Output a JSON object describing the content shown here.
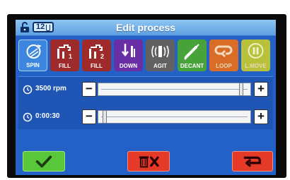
{
  "header": {
    "title": "Edit process",
    "lock_icon": "unlock-icon",
    "tube_count": "12"
  },
  "steps": [
    {
      "label": "SPIN",
      "icon": "spin-icon",
      "color": "#3d86e0",
      "selected": true
    },
    {
      "label": "FILL",
      "icon": "faucet-1-icon",
      "color": "#9e2a2a"
    },
    {
      "label": "FILL",
      "icon": "faucet-2-icon",
      "color": "#9e2a2a"
    },
    {
      "label": "DOWN",
      "icon": "down-arrow-icon",
      "color": "#6a2fa5"
    },
    {
      "label": "AGIT",
      "icon": "vibrate-icon",
      "color": "#616161"
    },
    {
      "label": "DECANT",
      "icon": "pipette-icon",
      "color": "#48a23a"
    },
    {
      "label": "LOOP",
      "icon": "loop-icon",
      "color": "#d96c26",
      "disabled": true
    },
    {
      "label": "L.MOVE",
      "icon": "pause-icon",
      "color": "#b7c23a",
      "disabled": true
    }
  ],
  "params": {
    "speed": {
      "value": "3500 rpm",
      "icon": "clock-icon",
      "level": 0.95
    },
    "time": {
      "value": "0:00:30",
      "icon": "clock-icon",
      "level": 0.03
    },
    "minus_label": "−",
    "plus_label": "+"
  },
  "actions": {
    "confirm_icon": "checkmark-icon",
    "delete_icon": "trash-x-icon",
    "back_icon": "return-arrow-icon"
  },
  "colors": {
    "screen": "#2361c6",
    "confirm": "#58c83a",
    "delete": "#e53a27",
    "back": "#e53a27"
  }
}
